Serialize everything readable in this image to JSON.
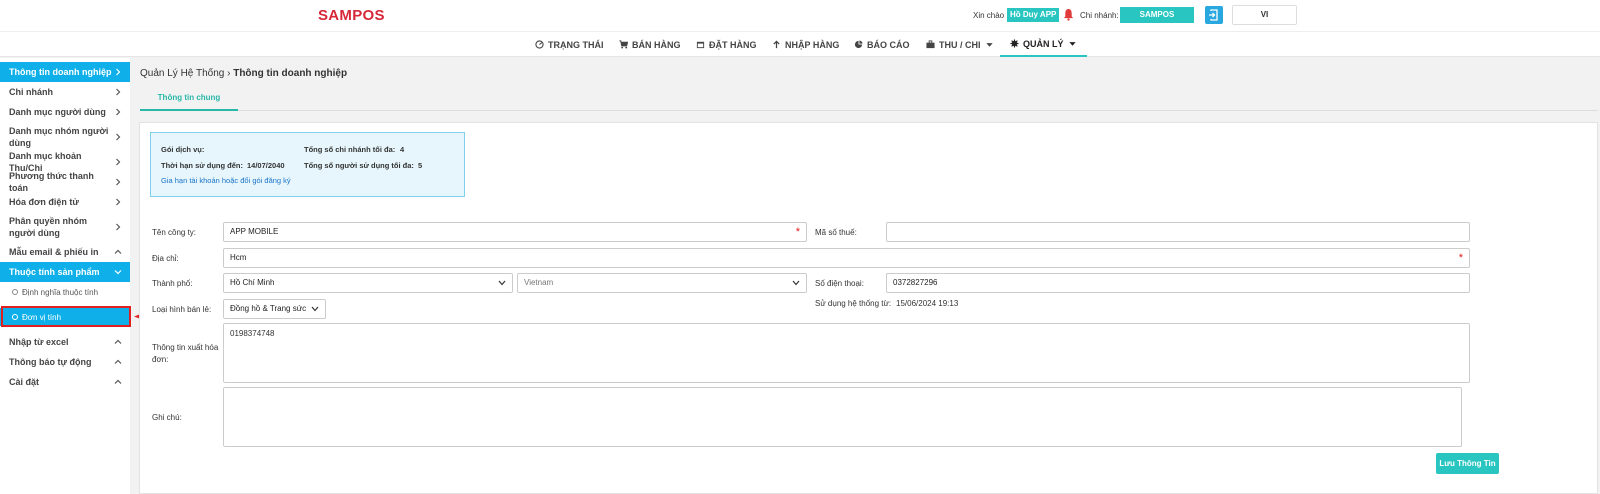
{
  "app": {
    "logo": "SAMPOS"
  },
  "header": {
    "greeting": "Xin chào",
    "user_name": "Hồ Duy APP",
    "branch_label": "Chi nhánh:",
    "branch_name": "SAMPOS",
    "language": "VI"
  },
  "nav": [
    {
      "label": "TRẠNG THÁI",
      "icon": "dashboard-icon"
    },
    {
      "label": "BÁN HÀNG",
      "icon": "cart-icon"
    },
    {
      "label": "ĐẶT HÀNG",
      "icon": "calendar-icon"
    },
    {
      "label": "NHẬP HÀNG",
      "icon": "arrow-up-icon"
    },
    {
      "label": "BÁO CÁO",
      "icon": "pie-chart-icon"
    },
    {
      "label": "THU / CHI",
      "icon": "briefcase-icon"
    },
    {
      "label": "QUẢN LÝ",
      "icon": "gear-icon"
    }
  ],
  "sidebar": {
    "items": [
      {
        "label": "Thông tin doanh nghiệp"
      },
      {
        "label": "Chi nhánh"
      },
      {
        "label": "Danh mục người dùng"
      },
      {
        "label": "Danh mục nhóm người dùng"
      },
      {
        "label": "Danh mục khoản Thu/Chi"
      },
      {
        "label": "Phương thức thanh toán"
      },
      {
        "label": "Hóa đơn điện tử"
      },
      {
        "label": "Phân quyền nhóm người dùng"
      },
      {
        "label": "Mẫu email & phiếu in"
      },
      {
        "label": "Thuộc tính sản phẩm"
      },
      {
        "label": "Nhập từ excel"
      },
      {
        "label": "Thông báo tự động"
      },
      {
        "label": "Cài đặt"
      }
    ],
    "subitems": [
      {
        "label": "Định nghĩa thuộc tính"
      },
      {
        "label": "Đơn vị tính"
      }
    ]
  },
  "breadcrumb": {
    "root": "Quản Lý Hệ Thống",
    "current": "Thông tin doanh nghiệp"
  },
  "tabs": {
    "general": "Thông tin chung"
  },
  "service_info": {
    "package_label": "Gói dịch vụ:",
    "expiry_label": "Thời hạn sử dụng đến:",
    "expiry_value": "14/07/2040",
    "renew_link": "Gia hạn tài khoản hoặc đổi gói đăng ký",
    "max_branches_label": "Tổng số chi nhánh tối đa:",
    "max_branches_value": "4",
    "max_users_label": "Tổng số người sử dụng tối đa:",
    "max_users_value": "5"
  },
  "form": {
    "company_label": "Tên công ty:",
    "company_value": "APP MOBILE",
    "tax_label": "Mã số thuế:",
    "tax_value": "",
    "address_label": "Địa chỉ:",
    "address_value": "Hcm",
    "city_label": "Thành phố:",
    "city_value": "Hồ Chí Minh",
    "country_value": "Vietnam",
    "phone_label": "Số điện thoại:",
    "phone_value": "0372827296",
    "retail_label": "Loại hình bán lẻ:",
    "retail_value": "Đồng hồ & Trang sức",
    "since_label": "Sử dụng hệ thống từ:",
    "since_value": "15/06/2024 19:13",
    "invoice_label": "Thông tin xuất hóa đơn:",
    "invoice_value": "0198374748",
    "note_label": "Ghi chú:",
    "note_value": "",
    "required_mark": "*",
    "save_label": "Lưu Thông Tin"
  }
}
